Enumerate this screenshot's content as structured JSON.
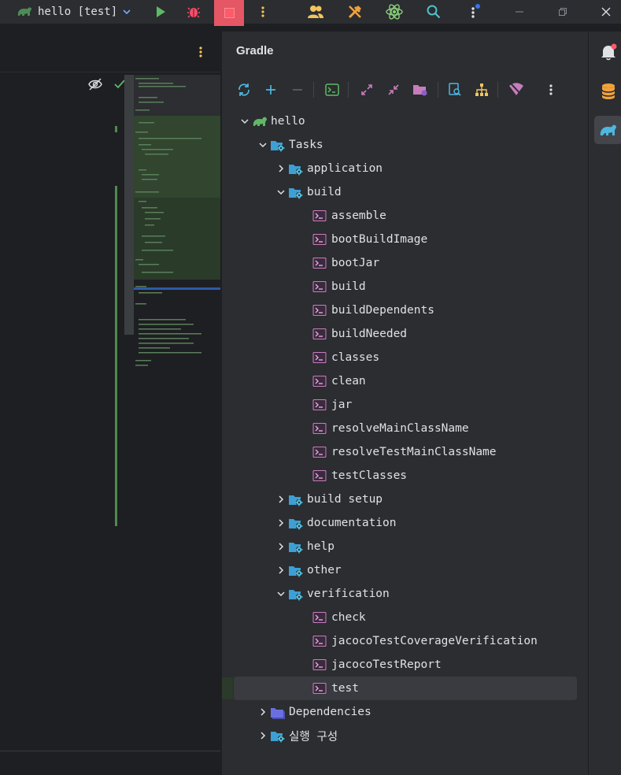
{
  "titlebar": {
    "run_config_label": "hello [test]",
    "icons": [
      "gradle-elephant-icon",
      "chevron-down-icon",
      "run-icon",
      "debug-icon",
      "stop-icon",
      "more-vertical-icon",
      "code-with-me-icon",
      "build-tools-icon",
      "atom-icon",
      "search-icon",
      "more-vertical-icon",
      "minimize-icon",
      "restore-icon",
      "close-icon"
    ]
  },
  "gradle": {
    "title": "Gradle",
    "tree": [
      {
        "label": "hello",
        "kind": "project",
        "depth": 0,
        "expanded": true
      },
      {
        "label": "Tasks",
        "kind": "folder",
        "depth": 1,
        "expanded": true
      },
      {
        "label": "application",
        "kind": "folder",
        "depth": 2,
        "expanded": false
      },
      {
        "label": "build",
        "kind": "folder",
        "depth": 2,
        "expanded": true
      },
      {
        "label": "assemble",
        "kind": "task",
        "depth": 3
      },
      {
        "label": "bootBuildImage",
        "kind": "task",
        "depth": 3
      },
      {
        "label": "bootJar",
        "kind": "task",
        "depth": 3
      },
      {
        "label": "build",
        "kind": "task",
        "depth": 3
      },
      {
        "label": "buildDependents",
        "kind": "task",
        "depth": 3
      },
      {
        "label": "buildNeeded",
        "kind": "task",
        "depth": 3
      },
      {
        "label": "classes",
        "kind": "task",
        "depth": 3
      },
      {
        "label": "clean",
        "kind": "task",
        "depth": 3
      },
      {
        "label": "jar",
        "kind": "task",
        "depth": 3
      },
      {
        "label": "resolveMainClassName",
        "kind": "task",
        "depth": 3
      },
      {
        "label": "resolveTestMainClassName",
        "kind": "task",
        "depth": 3
      },
      {
        "label": "testClasses",
        "kind": "task",
        "depth": 3
      },
      {
        "label": "build setup",
        "kind": "folder",
        "depth": 2,
        "expanded": false
      },
      {
        "label": "documentation",
        "kind": "folder",
        "depth": 2,
        "expanded": false
      },
      {
        "label": "help",
        "kind": "folder",
        "depth": 2,
        "expanded": false
      },
      {
        "label": "other",
        "kind": "folder",
        "depth": 2,
        "expanded": false
      },
      {
        "label": "verification",
        "kind": "folder",
        "depth": 2,
        "expanded": true
      },
      {
        "label": "check",
        "kind": "task",
        "depth": 3
      },
      {
        "label": "jacocoTestCoverageVerification",
        "kind": "task",
        "depth": 3
      },
      {
        "label": "jacocoTestReport",
        "kind": "task",
        "depth": 3
      },
      {
        "label": "test",
        "kind": "task",
        "depth": 3,
        "selected": true
      },
      {
        "label": "Dependencies",
        "kind": "dependencies",
        "depth": 1,
        "expanded": false
      },
      {
        "label": "실행 구성",
        "kind": "folder",
        "depth": 1,
        "expanded": false
      }
    ]
  },
  "colors": {
    "accent": "#3574f0",
    "task_icon": "#c77dbb",
    "folder_icon": "#3d9fd4",
    "gradle_green": "#5fb865",
    "run_green": "#5fb865",
    "stop_red": "#e55765"
  }
}
